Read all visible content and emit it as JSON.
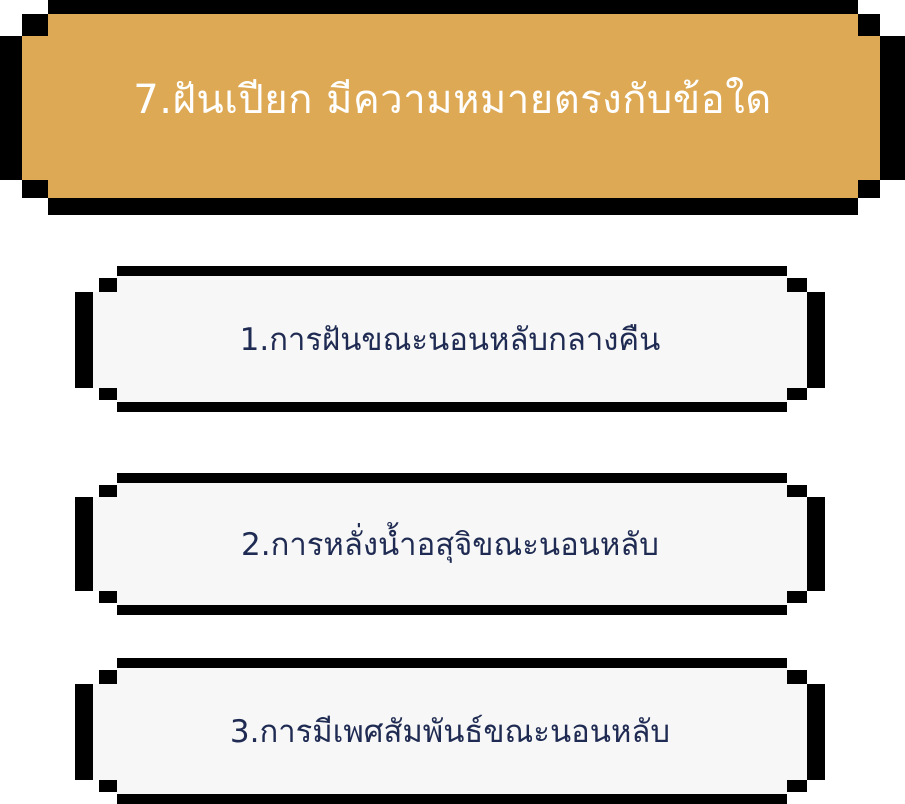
{
  "question": {
    "text": "7.ฝันเปียก มีความหมายตรงกับข้อใด"
  },
  "answers": [
    {
      "label": "1.การฝันขณะนอนหลับกลางคืน"
    },
    {
      "label": "2.การหลั่งน้ำอสุจิขณะนอนหลับ"
    },
    {
      "label": "3.การมีเพศสัมพันธ์ขณะนอนหลับ"
    }
  ],
  "colors": {
    "question_fill": "#dda954",
    "question_text": "#ffffff",
    "answer_fill": "#f7f7f7",
    "answer_text": "#1f2b52",
    "border": "#000000"
  }
}
